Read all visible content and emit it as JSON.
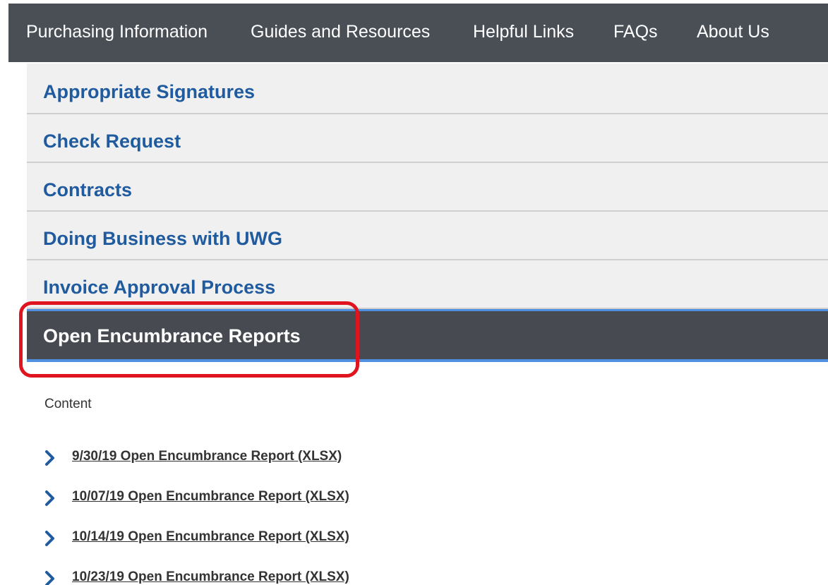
{
  "top_nav": {
    "items": [
      {
        "label": "Purchasing Information"
      },
      {
        "label": "Guides and Resources"
      },
      {
        "label": "Helpful Links"
      },
      {
        "label": "FAQs"
      },
      {
        "label": "About Us"
      }
    ]
  },
  "accordion": {
    "items": [
      {
        "label": "Appropriate Signatures"
      },
      {
        "label": "Check Request"
      },
      {
        "label": "Contracts"
      },
      {
        "label": "Doing Business with UWG"
      },
      {
        "label": "Invoice Approval Process"
      },
      {
        "label": "Open Encumbrance Reports",
        "active": true
      }
    ]
  },
  "content": {
    "label": "Content",
    "links": [
      {
        "text": "9/30/19 Open Encumbrance Report (XLSX)",
        "icon": "chevron-right-icon"
      },
      {
        "text": "10/07/19 Open Encumbrance Report (XLSX)",
        "icon": "chevron-right-icon"
      },
      {
        "text": "10/14/19 Open Encumbrance Report (XLSX)",
        "icon": "chevron-right-icon"
      },
      {
        "text": "10/23/19 Open Encumbrance Report (XLSX)",
        "icon": "chevron-right-icon"
      }
    ]
  },
  "colors": {
    "nav_bg": "#4a4e55",
    "link_blue": "#1f5b9e",
    "active_bg": "#474a51",
    "active_border": "#4f8fe0",
    "highlight_red": "#e0141e"
  }
}
